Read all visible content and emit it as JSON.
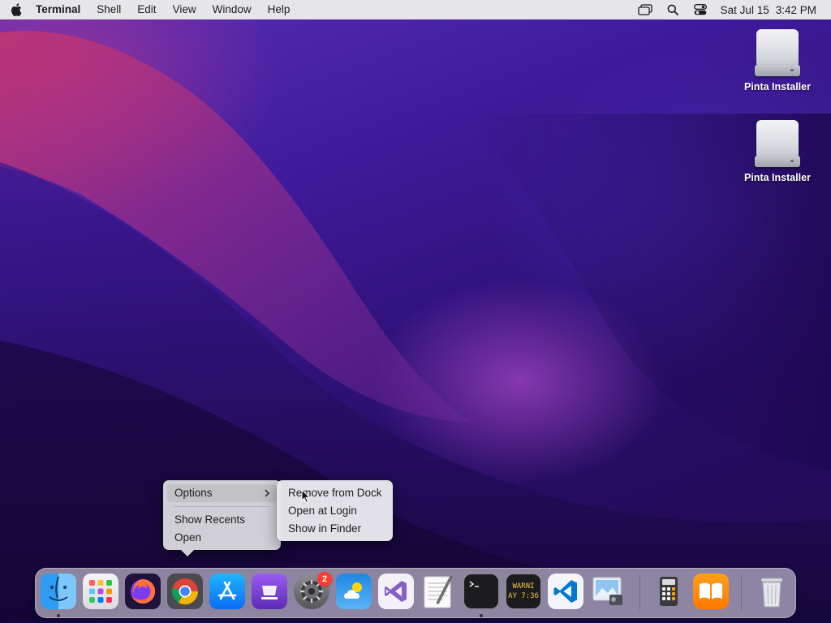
{
  "menubar": {
    "app_name": "Terminal",
    "menus": [
      "Shell",
      "Edit",
      "View",
      "Window",
      "Help"
    ],
    "status_icons": [
      "screen-mirroring-icon",
      "spotlight-icon",
      "control-center-icon"
    ],
    "date": "Sat Jul 15",
    "time": "3:42 PM"
  },
  "desktop_icons": [
    {
      "label": "Pinta Installer",
      "icon": "disk-image-icon"
    },
    {
      "label": "Pinta Installer",
      "icon": "disk-image-icon"
    }
  ],
  "context_menu": {
    "items": [
      {
        "label": "Options",
        "has_submenu": true,
        "highlighted": true
      },
      {
        "label": "Show Recents"
      },
      {
        "label": "Open"
      }
    ],
    "submenu": {
      "items": [
        {
          "label": "Remove from Dock"
        },
        {
          "label": "Open at Login"
        },
        {
          "label": "Show in Finder"
        }
      ]
    }
  },
  "dock": {
    "apps": [
      {
        "name": "Finder",
        "icon": "finder-icon",
        "running": true
      },
      {
        "name": "Launchpad",
        "icon": "launchpad-icon"
      },
      {
        "name": "Firefox",
        "icon": "firefox-icon"
      },
      {
        "name": "Chrome",
        "icon": "chrome-icon"
      },
      {
        "name": "App Store",
        "icon": "app-store-icon"
      },
      {
        "name": "Apple Configurator",
        "icon": "configurator-icon"
      },
      {
        "name": "System Preferences",
        "icon": "system-preferences-icon",
        "badge": "2"
      },
      {
        "name": "Weather",
        "icon": "weather-icon"
      },
      {
        "name": "Visual Studio",
        "icon": "visual-studio-icon"
      },
      {
        "name": "TextEdit",
        "icon": "textedit-icon"
      },
      {
        "name": "Terminal",
        "icon": "terminal-icon",
        "running": true
      },
      {
        "name": "Console",
        "icon": "console-icon",
        "text": [
          "WARNI",
          "AY 7:36"
        ]
      },
      {
        "name": "Visual Studio Code",
        "icon": "vscode-icon"
      },
      {
        "name": "Preview",
        "icon": "preview-icon"
      },
      {
        "name": "Calculator",
        "icon": "calculator-icon"
      },
      {
        "name": "Books",
        "icon": "books-icon"
      },
      {
        "name": "Trash",
        "icon": "trash-icon"
      }
    ]
  },
  "colors": {
    "menubar_bg": "#e6e6e8",
    "badge": "#ff3b30",
    "wallpaper_dark": "#1e0a4c",
    "wallpaper_accent": "#c23fa0"
  }
}
